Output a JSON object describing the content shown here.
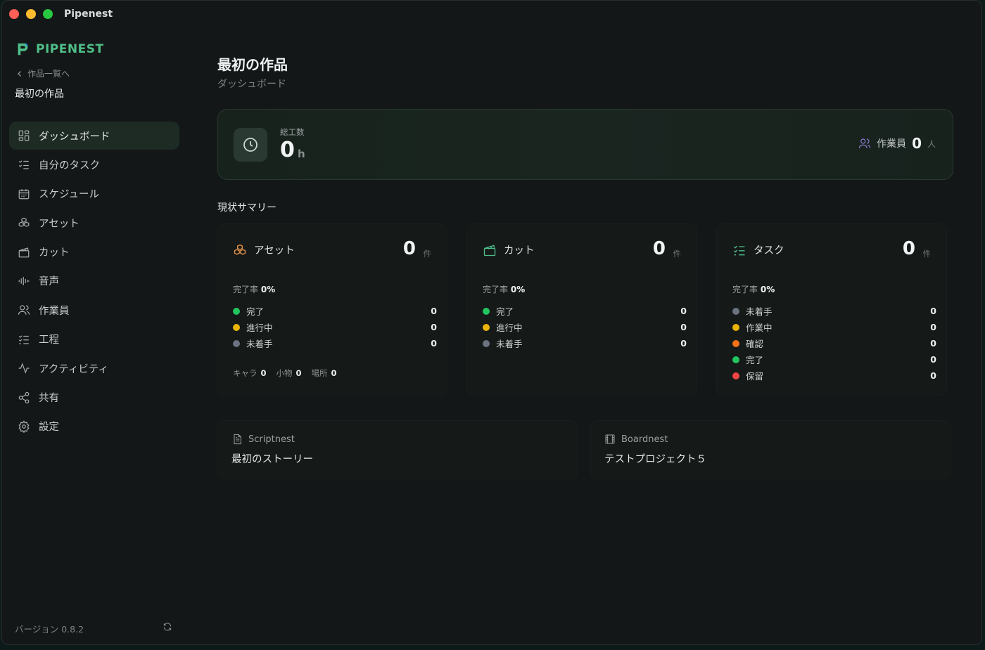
{
  "window": {
    "title": "Pipenest"
  },
  "sidebar": {
    "brand": "PIPENEST",
    "back_label": "作品一覧へ",
    "project_name": "最初の作品",
    "items": [
      {
        "label": "ダッシュボード",
        "icon": "dashboard-icon",
        "active": true
      },
      {
        "label": "自分のタスク",
        "icon": "checklist-icon"
      },
      {
        "label": "スケジュール",
        "icon": "calendar-icon"
      },
      {
        "label": "アセット",
        "icon": "boxes-icon"
      },
      {
        "label": "カット",
        "icon": "clapperboard-icon"
      },
      {
        "label": "音声",
        "icon": "audio-wave-icon"
      },
      {
        "label": "作業員",
        "icon": "users-icon"
      },
      {
        "label": "工程",
        "icon": "list-checks-icon"
      },
      {
        "label": "アクティビティ",
        "icon": "activity-icon"
      },
      {
        "label": "共有",
        "icon": "share-icon"
      },
      {
        "label": "設定",
        "icon": "gear-icon"
      }
    ],
    "version": "バージョン 0.8.2"
  },
  "header": {
    "title": "最初の作品",
    "subtitle": "ダッシュボード"
  },
  "hero": {
    "label": "総工数",
    "value": "0",
    "unit": "h",
    "workers_label": "作業員",
    "workers_value": "0",
    "workers_unit": "人"
  },
  "summary": {
    "title": "現状サマリー",
    "cards": [
      {
        "title": "アセット",
        "count": "0",
        "count_unit": "件",
        "rate_label": "完了率",
        "rate_value": "0%",
        "statuses": [
          {
            "label": "完了",
            "value": "0",
            "color": "#22c55e"
          },
          {
            "label": "進行中",
            "value": "0",
            "color": "#eab308"
          },
          {
            "label": "未着手",
            "value": "0",
            "color": "#6b7280"
          }
        ],
        "footer": [
          {
            "label": "キャラ",
            "value": "0"
          },
          {
            "label": "小物",
            "value": "0"
          },
          {
            "label": "場所",
            "value": "0"
          }
        ]
      },
      {
        "title": "カット",
        "count": "0",
        "count_unit": "件",
        "rate_label": "完了率",
        "rate_value": "0%",
        "statuses": [
          {
            "label": "完了",
            "value": "0",
            "color": "#22c55e"
          },
          {
            "label": "進行中",
            "value": "0",
            "color": "#eab308"
          },
          {
            "label": "未着手",
            "value": "0",
            "color": "#6b7280"
          }
        ]
      },
      {
        "title": "タスク",
        "count": "0",
        "count_unit": "件",
        "rate_label": "完了率",
        "rate_value": "0%",
        "statuses": [
          {
            "label": "未着手",
            "value": "0",
            "color": "#6b7280"
          },
          {
            "label": "作業中",
            "value": "0",
            "color": "#eab308"
          },
          {
            "label": "確認",
            "value": "0",
            "color": "#f97316"
          },
          {
            "label": "完了",
            "value": "0",
            "color": "#22c55e"
          },
          {
            "label": "保留",
            "value": "0",
            "color": "#ef4444"
          }
        ]
      }
    ]
  },
  "links": [
    {
      "app": "Scriptnest",
      "title": "最初のストーリー",
      "icon": "document-icon"
    },
    {
      "app": "Boardnest",
      "title": "テストプロジェクト５",
      "icon": "film-icon"
    }
  ],
  "colors": {
    "accent": "#4fbf8a",
    "background": "#141717"
  }
}
